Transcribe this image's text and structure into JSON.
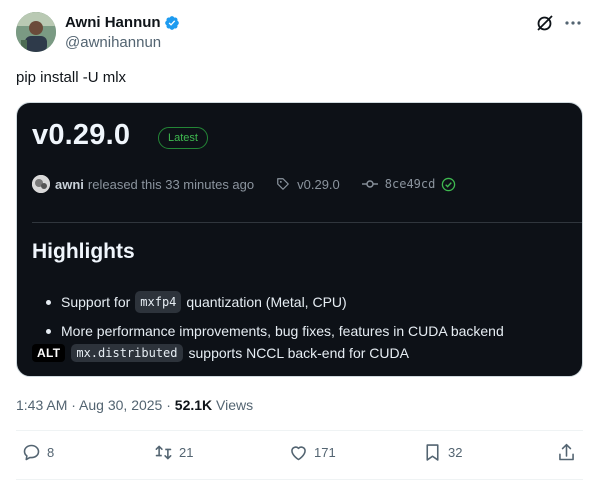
{
  "author": {
    "display_name": "Awni Hannun",
    "handle": "@awnihannun"
  },
  "icons": {
    "verified": "verified-badge-icon",
    "grok": "grok-icon",
    "more": "more-icon"
  },
  "tweet": {
    "text": "pip install -U mlx"
  },
  "release_card": {
    "version": "v0.29.0",
    "badge": "Latest",
    "release_user": "awni",
    "release_time": "released this 33 minutes ago",
    "tag": "v0.29.0",
    "commit": "8ce49cd",
    "section_heading": "Highlights",
    "bullets": [
      {
        "before": "Support for",
        "code": "mxfp4",
        "after": "quantization (Metal, CPU)"
      },
      {
        "text": "More performance improvements, bug fixes, features in CUDA backend"
      }
    ],
    "alt_label": "ALT",
    "last_line": {
      "code": "mx.distributed",
      "after": "supports NCCL back-end for CUDA"
    }
  },
  "meta": {
    "time": "1:43 AM",
    "date": "Aug 30, 2025",
    "views_count": "52.1K",
    "views_label": "Views"
  },
  "actions": {
    "replies": "8",
    "reposts": "21",
    "likes": "171",
    "bookmarks": "32"
  },
  "colors": {
    "accent": "#1d9bf0",
    "card_bg": "#0d1117",
    "latest_green": "#3fb950"
  }
}
